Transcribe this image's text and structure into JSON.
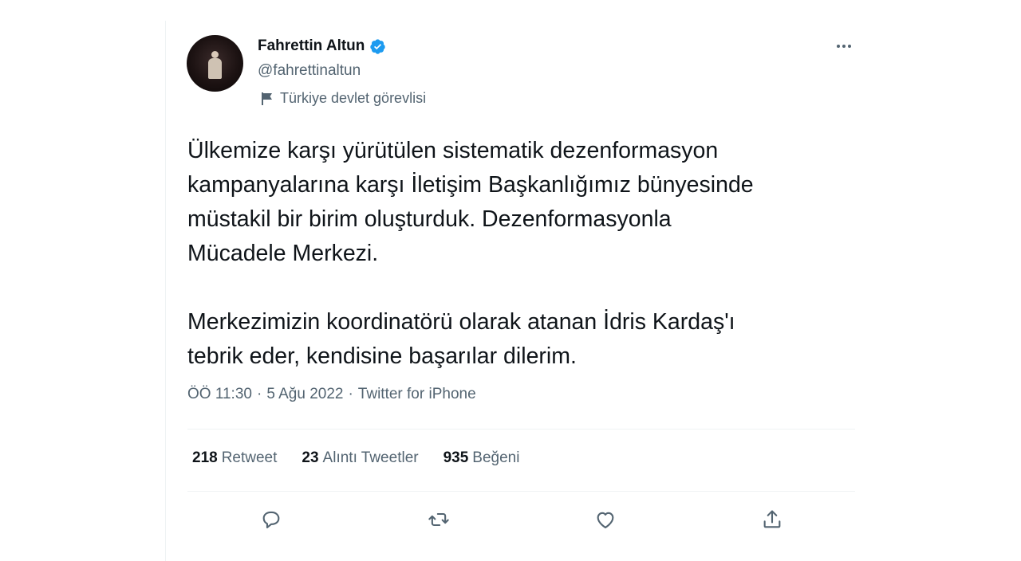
{
  "tweet": {
    "author": {
      "name": "Fahrettin Altun",
      "handle": "@fahrettinaltun",
      "label": "Türkiye devlet görevlisi",
      "verified": true
    },
    "text": "Ülkemize karşı yürütülen sistematik dezenformasyon\nkampanyalarına karşı İletişim Başkanlığımız bünyesinde\nmüstakil bir birim oluşturduk. Dezenformasyonla\nMücadele Merkezi.\n\nMerkezimizin koordinatörü olarak atanan İdris Kardaş'ı\ntebrik eder, kendisine başarılar dilerim.",
    "time": "ÖÖ 11:30",
    "date": "5 Ağu 2022",
    "separator": "·",
    "source": "Twitter for iPhone",
    "stats": {
      "retweets": {
        "count": "218",
        "label": "Retweet"
      },
      "quotes": {
        "count": "23",
        "label": "Alıntı Tweetler"
      },
      "likes": {
        "count": "935",
        "label": "Beğeni"
      }
    }
  },
  "colors": {
    "text_primary": "#0f1419",
    "text_secondary": "#536471",
    "divider": "#eff3f4",
    "verified_blue": "#1d9bf0"
  },
  "icons": {
    "more": "more-horizontal-icon",
    "verified": "verified-badge-icon",
    "label": "flag-icon",
    "reply": "reply-icon",
    "retweet": "retweet-icon",
    "like": "heart-icon",
    "share": "share-icon"
  }
}
